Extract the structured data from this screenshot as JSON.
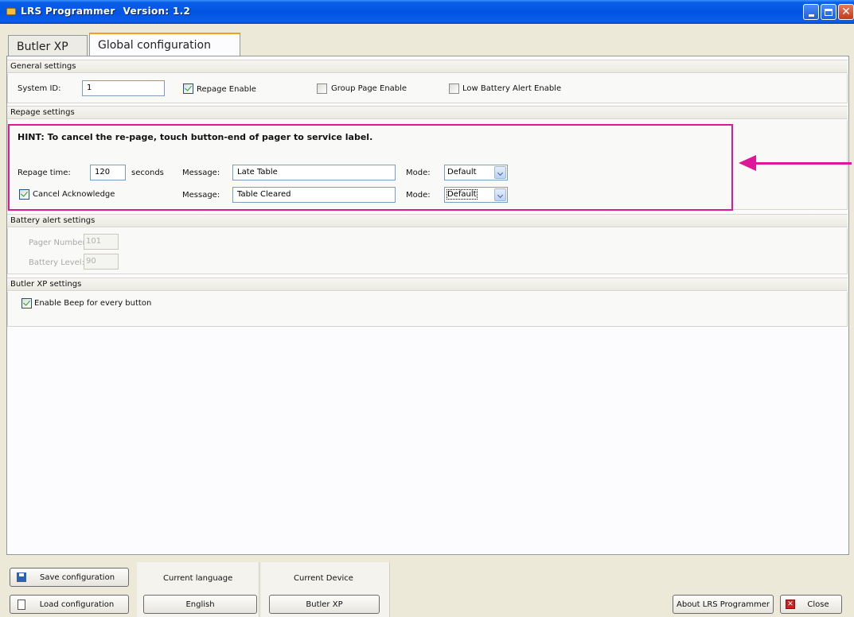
{
  "window": {
    "title": "LRS Programmer",
    "version": "Version: 1.2"
  },
  "tabs": [
    {
      "label": "Butler XP",
      "active": false
    },
    {
      "label": "Global configuration",
      "active": true
    }
  ],
  "general_settings": {
    "header": "General settings",
    "system_id_label": "System ID:",
    "system_id_value": "1",
    "repage_enable_label": "Repage Enable",
    "repage_enable_checked": true,
    "group_page_enable_label": "Group Page Enable",
    "group_page_enable_checked": false,
    "low_battery_label": "Low Battery Alert Enable",
    "low_battery_checked": false
  },
  "repage_settings": {
    "header": "Repage settings",
    "hint": "HINT: To cancel the re-page, touch button-end of pager to service label.",
    "repage_time_label": "Repage time:",
    "repage_time_value": "120",
    "seconds_label": "seconds",
    "message_label": "Message:",
    "message1_value": "Late Table",
    "mode_label": "Mode:",
    "mode1_value": "Default",
    "cancel_ack_label": "Cancel Acknowledge",
    "cancel_ack_checked": true,
    "message2_value": "Table Cleared",
    "mode2_value": "Default"
  },
  "battery_settings": {
    "header": "Battery alert settings",
    "pager_number_label": "Pager Number:",
    "pager_number_value": "101",
    "battery_level_label": "Battery Level:",
    "battery_level_value": "90"
  },
  "butler_settings": {
    "header": "Butler XP settings",
    "beep_label": "Enable Beep for every button",
    "beep_checked": true
  },
  "bottom": {
    "save_button": "Save configuration",
    "load_button": "Load configuration",
    "current_language_title": "Current language",
    "current_language_value": "English",
    "current_device_title": "Current Device",
    "current_device_value": "Butler XP",
    "about_button": "About LRS Programmer",
    "close_button": "Close"
  },
  "colors": {
    "highlight": "#e01898",
    "titlebar": "#0054e3",
    "background": "#ece9d8"
  },
  "icons": [
    "app-icon",
    "minimize-icon",
    "maximize-icon",
    "close-icon",
    "save-icon",
    "load-icon",
    "close-button-icon",
    "dropdown-arrow-icon",
    "checkbox-tick-icon"
  ]
}
